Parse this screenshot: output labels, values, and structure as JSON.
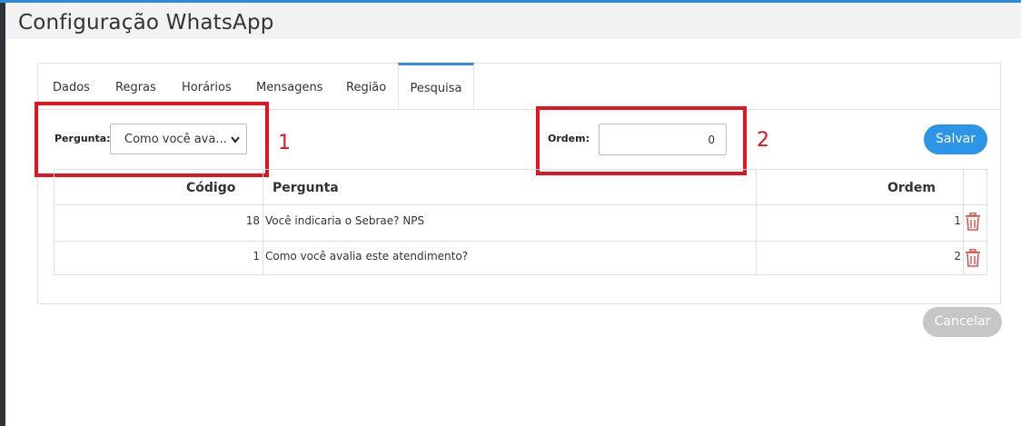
{
  "window": {
    "title": "Configuração WhatsApp"
  },
  "tabs": [
    {
      "label": "Dados"
    },
    {
      "label": "Regras"
    },
    {
      "label": "Horários"
    },
    {
      "label": "Mensagens"
    },
    {
      "label": "Região"
    },
    {
      "label": "Pesquisa",
      "active": true
    }
  ],
  "form": {
    "question_label": "Pergunta:",
    "question_value": "Como você ava...",
    "order_label": "Ordem:",
    "order_value": "0",
    "save_label": "Salvar",
    "cancel_label": "Cancelar"
  },
  "annotations": [
    "1",
    "2"
  ],
  "table": {
    "headers": [
      "Código",
      "Pergunta",
      "Ordem"
    ],
    "rows": [
      {
        "code": "18",
        "question": "Você indicaria o Sebrae? NPS",
        "order": "1"
      },
      {
        "code": "1",
        "question": "Como você avalia este atendimento?",
        "order": "2"
      }
    ]
  },
  "icons": {
    "delete": "trash-icon",
    "dropdown": "chevron-down-icon"
  },
  "colors": {
    "accent": "#2f8be0",
    "annotation": "#e3141f",
    "delete": "#d9534f",
    "disabled": "#c6c6c6"
  }
}
